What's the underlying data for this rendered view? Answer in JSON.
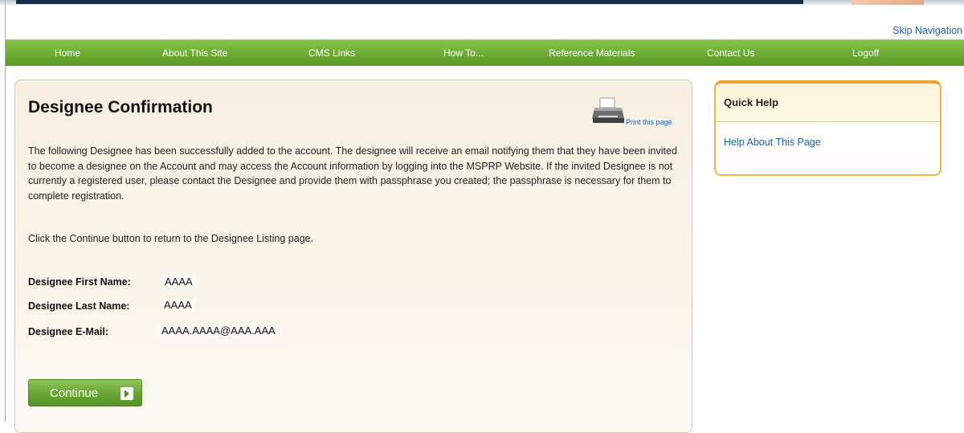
{
  "header": {
    "skip_navigation": "Skip Navigation"
  },
  "nav": {
    "items": [
      {
        "label": "Home"
      },
      {
        "label": "About This Site"
      },
      {
        "label": "CMS Links"
      },
      {
        "label": "How To..."
      },
      {
        "label": "Reference Materials"
      },
      {
        "label": "Contact Us"
      },
      {
        "label": "Logoff"
      }
    ]
  },
  "main": {
    "title": "Designee Confirmation",
    "print_link": "Print this page",
    "intro": "The following Designee has been successfully added to the account. The designee will receive an email notifying them that they have been invited to become a designee on the Account and may access the Account information by logging into the MSPRP Website. If the invited Designee is not currently a registered user, please contact the Designee and provide them with passphrase you created; the passphrase is necessary for them to complete registration.",
    "instruction": "Click the Continue button to return to the Designee Listing page.",
    "fields": [
      {
        "label": "Designee First Name:",
        "value": "AAAA"
      },
      {
        "label": "Designee Last Name:",
        "value": "AAAA"
      },
      {
        "label": "Designee E-Mail:",
        "value": "AAAA.AAAA@AAA.AAA"
      }
    ],
    "continue_button": "Continue"
  },
  "quick_help": {
    "title": "Quick Help",
    "link": "Help About This Page"
  },
  "colors": {
    "nav_green": "#6cab33",
    "link_blue": "#1a5fb4",
    "panel_beige": "#f7efe1",
    "help_orange": "#f0a030"
  }
}
